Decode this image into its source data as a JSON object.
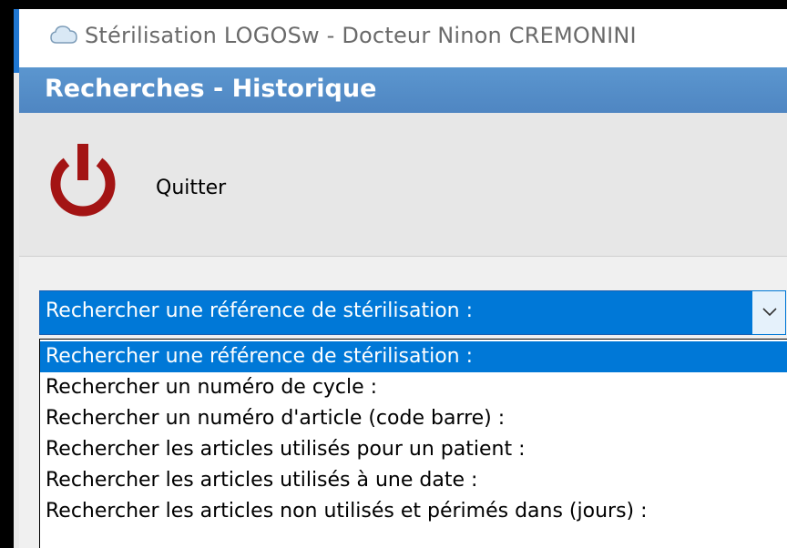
{
  "window": {
    "title": "Stérilisation LOGOSw - Docteur Ninon CREMONINI",
    "app_icon": "cloud-icon"
  },
  "panel": {
    "heading": "Recherches - Historique"
  },
  "toolbar": {
    "quit_label": "Quitter",
    "quit_icon": "power-icon",
    "quit_color": "#a31414"
  },
  "search": {
    "selected": "Rechercher une référence de stérilisation :",
    "options": [
      "Rechercher une référence de stérilisation :",
      "Rechercher un numéro de cycle :",
      "Rechercher un numéro d'article (code barre) :",
      "Rechercher les articles utilisés pour un patient :",
      "Rechercher les articles utilisés à une date :",
      "Rechercher les articles non utilisés et périmés dans (jours) :"
    ],
    "highlight_color": "#0078d7"
  }
}
